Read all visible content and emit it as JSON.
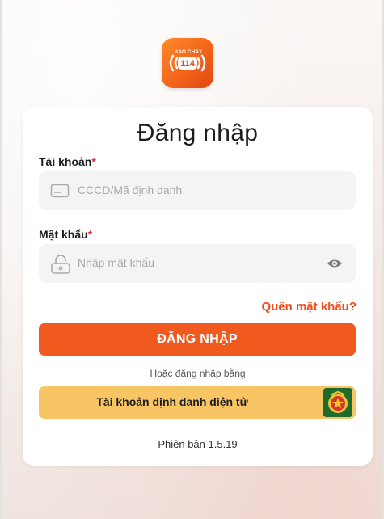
{
  "logo": {
    "top_text": "BÁO CHÁY",
    "number": "114"
  },
  "login": {
    "title": "Đăng nhập",
    "account_label": "Tài khoản",
    "account_placeholder": "CCCD/Mã định danh",
    "password_label": "Mật khẩu",
    "password_placeholder": "Nhập mật khẩu",
    "required_mark": "*",
    "forgot_password": "Quên mật khẩu?",
    "submit_label": "ĐĂNG NHẬP",
    "alt_login_text": "Hoặc đăng nhập bằng",
    "vneid_button_label": "Tài khoản định danh điện tử",
    "version": "Phiên bản 1.5.19"
  },
  "colors": {
    "accent": "#f05a1e",
    "link": "#ef4d1b",
    "required": "#e5322d",
    "vneid_bg": "#f8c565"
  },
  "icons": {
    "account_field": "id-card-icon",
    "password_field": "lock-icon",
    "password_toggle": "eye-icon",
    "vneid": "police-emblem-icon"
  }
}
